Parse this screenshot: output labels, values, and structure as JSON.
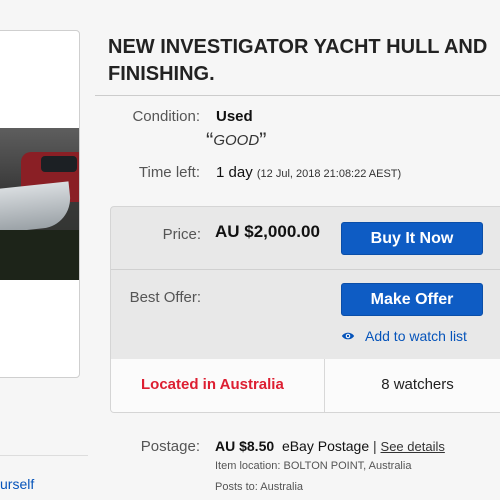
{
  "title": {
    "line1": "NEW INVESTIGATOR YACHT HULL AND",
    "line2": "FINISHING."
  },
  "left": {
    "link_fragment": "urself"
  },
  "condition": {
    "label": "Condition:",
    "value": "Used",
    "note": "GOOD"
  },
  "time_left": {
    "label": "Time left:",
    "value": "1 day",
    "detail": "(12 Jul, 2018   21:08:22 AEST)"
  },
  "price": {
    "label": "Price:",
    "value": "AU $2,000.00",
    "buy_button": "Buy It Now"
  },
  "best_offer": {
    "label": "Best Offer:",
    "offer_button": "Make Offer",
    "watch_link": "Add to watch list"
  },
  "location_strip": {
    "located": "Located in Australia",
    "watchers": "8 watchers"
  },
  "postage": {
    "label": "Postage:",
    "amount": "AU $8.50",
    "service": "eBay Postage",
    "details_link": "See details",
    "item_location": "Item location:  BOLTON POINT, Australia",
    "posts_to": "Posts to:  Australia"
  },
  "colors": {
    "button_blue": "#0e5cc4",
    "link_blue": "#0654ba",
    "located_red": "#dd1e31"
  },
  "icons": {
    "watch": "eye-icon"
  }
}
